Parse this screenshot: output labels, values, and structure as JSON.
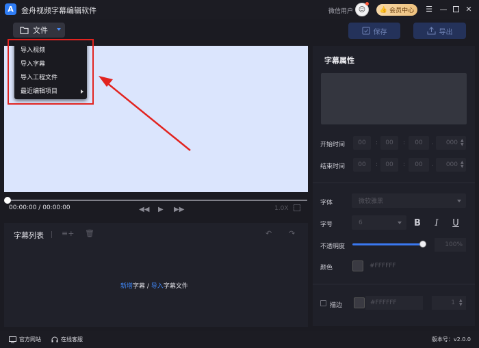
{
  "titlebar": {
    "app_name": "金舟视频字幕编辑软件",
    "logo_letter": "A",
    "user_name": "微信用户",
    "vip_label": "会员中心",
    "menu_icon": "hamburger-icon",
    "min_icon": "minimize-icon",
    "max_icon": "maximize-icon",
    "close_icon": "close-icon"
  },
  "toolbar": {
    "file_label": "文件",
    "save_label": "保存",
    "export_label": "导出"
  },
  "file_menu": {
    "items": [
      {
        "label": "导入视频"
      },
      {
        "label": "导入字幕"
      },
      {
        "label": "导入工程文件"
      },
      {
        "label": "最近编辑项目",
        "has_submenu": true
      }
    ]
  },
  "annotation": {
    "color": "#e2231f"
  },
  "player": {
    "current_time": "00:00:00",
    "separator": "/",
    "total_time": "00:00:00",
    "speed": "1.0X",
    "progress": 0
  },
  "subtitle_list": {
    "title": "字幕列表",
    "empty_hint": {
      "add_link": "新增",
      "add_text": "字幕",
      "slash": " / ",
      "import_link": "导入",
      "import_text": "字幕文件"
    }
  },
  "properties": {
    "title": "字幕属性",
    "start_label": "开始时间",
    "end_label": "结束时间",
    "start_time": {
      "h": "00",
      "m": "00",
      "s": "00",
      "ms": "000"
    },
    "end_time": {
      "h": "00",
      "m": "00",
      "s": "00",
      "ms": "000"
    },
    "time_sep_colon": ":",
    "time_sep_dot": ".",
    "font_label": "字体",
    "font_value": "微软雅黑",
    "size_label": "字号",
    "size_value": "6",
    "bold": "B",
    "italic": "I",
    "underline": "U",
    "opacity_label": "不透明度",
    "opacity_value": "100%",
    "opacity_level": 1.0,
    "color_label": "颜色",
    "color_value": "#FFFFFF",
    "stroke_label": "描边",
    "stroke_color": "#FFFFFF",
    "stroke_width": "1"
  },
  "footer": {
    "website": "官方网站",
    "support": "在线客服",
    "version": "版本号：v2.0.0"
  },
  "colors": {
    "accent": "#3a78f0",
    "preview_bg": "#dbe5fd"
  }
}
